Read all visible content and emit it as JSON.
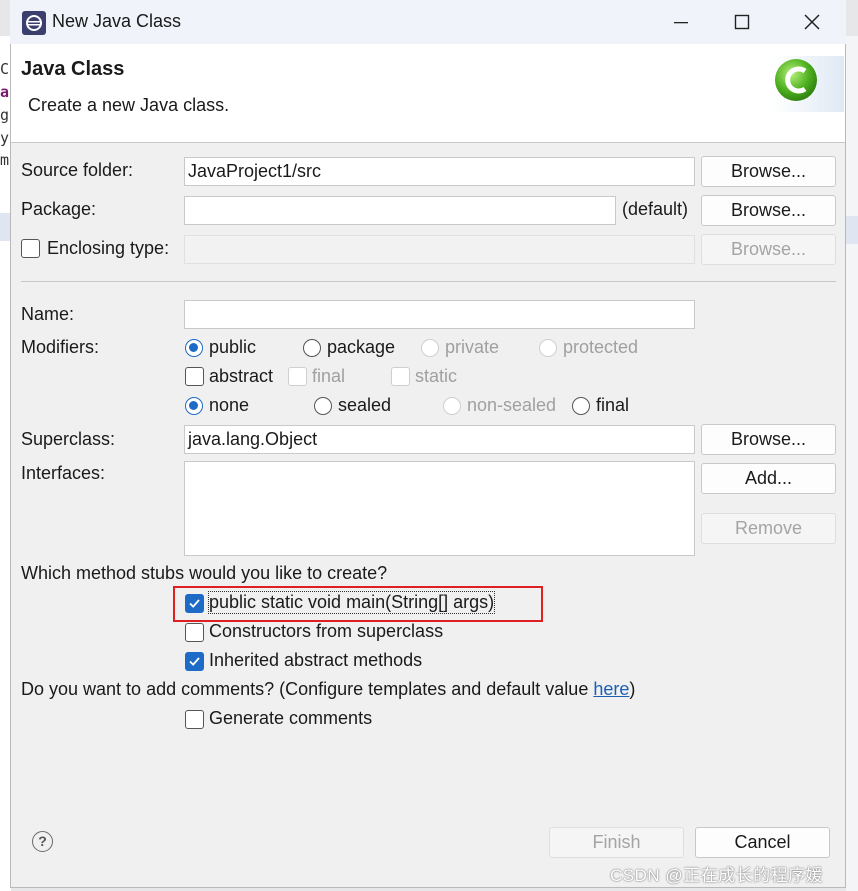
{
  "window": {
    "title": "New Java Class"
  },
  "header": {
    "title": "Java Class",
    "message": "Create a new Java class."
  },
  "background_chars": [
    "C",
    "a",
    "g",
    "y",
    "m"
  ],
  "source_folder": {
    "label": "Source folder:",
    "value": "JavaProject1/src",
    "browse": "Browse..."
  },
  "package": {
    "label": "Package:",
    "value": "",
    "default_note": "(default)",
    "browse": "Browse..."
  },
  "enclosing": {
    "label": "Enclosing type:",
    "checked": false,
    "value": "",
    "browse": "Browse..."
  },
  "name": {
    "label": "Name:",
    "value": ""
  },
  "modifiers": {
    "label": "Modifiers:",
    "access": [
      {
        "label": "public",
        "selected": true,
        "enabled": true
      },
      {
        "label": "package",
        "selected": false,
        "enabled": true
      },
      {
        "label": "private",
        "selected": false,
        "enabled": false
      },
      {
        "label": "protected",
        "selected": false,
        "enabled": false
      }
    ],
    "flags": [
      {
        "label": "abstract",
        "checked": false,
        "enabled": true
      },
      {
        "label": "final",
        "checked": false,
        "enabled": false
      },
      {
        "label": "static",
        "checked": false,
        "enabled": false
      }
    ],
    "sealing": [
      {
        "label": "none",
        "selected": true,
        "enabled": true
      },
      {
        "label": "sealed",
        "selected": false,
        "enabled": true
      },
      {
        "label": "non-sealed",
        "selected": false,
        "enabled": false
      },
      {
        "label": "final",
        "selected": false,
        "enabled": true
      }
    ]
  },
  "superclass": {
    "label": "Superclass:",
    "value": "java.lang.Object",
    "browse": "Browse..."
  },
  "interfaces": {
    "label": "Interfaces:",
    "add": "Add...",
    "remove": "Remove"
  },
  "stubs": {
    "question": "Which method stubs would you like to create?",
    "items": [
      {
        "label": "public static void main(String[] args)",
        "checked": true
      },
      {
        "label": "Constructors from superclass",
        "checked": false
      },
      {
        "label": "Inherited abstract methods",
        "checked": true
      }
    ]
  },
  "comments": {
    "question": "Do you want to add comments? (Configure templates and default value ",
    "link": "here",
    "question_end": ")",
    "generate": {
      "label": "Generate comments",
      "checked": false
    }
  },
  "footer": {
    "finish": "Finish",
    "cancel": "Cancel",
    "help": "?"
  },
  "watermark": "CSDN @正在成长的程序媛",
  "colors": {
    "accent": "#1e6bc7",
    "highlight_box": "#e02020",
    "link": "#1a5fb4"
  }
}
